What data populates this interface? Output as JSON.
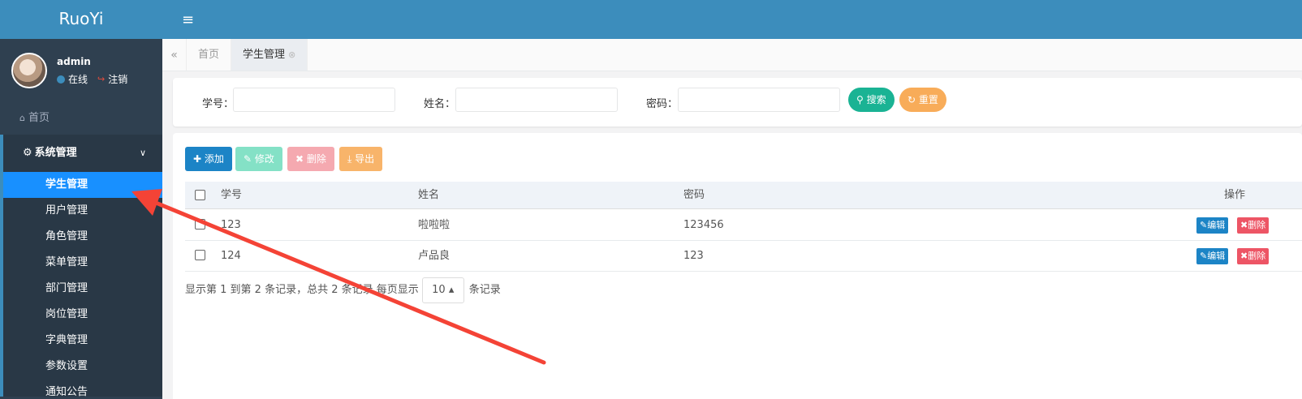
{
  "app": {
    "logo": "RuoYi"
  },
  "user": {
    "name": "admin",
    "status": "在线",
    "logout": "注销"
  },
  "sidebar": {
    "home": "首页",
    "group": "系统管理",
    "items": [
      {
        "label": "学生管理",
        "active": true
      },
      {
        "label": "用户管理"
      },
      {
        "label": "角色管理"
      },
      {
        "label": "菜单管理"
      },
      {
        "label": "部门管理"
      },
      {
        "label": "岗位管理"
      },
      {
        "label": "字典管理"
      },
      {
        "label": "参数设置"
      },
      {
        "label": "通知公告"
      }
    ]
  },
  "tabs": [
    {
      "label": "首页"
    },
    {
      "label": "学生管理",
      "active": true
    }
  ],
  "search": {
    "fields": [
      {
        "label": "学号：",
        "value": ""
      },
      {
        "label": "姓名：",
        "value": ""
      },
      {
        "label": "密码：",
        "value": ""
      }
    ],
    "search_label": "搜索",
    "reset_label": "重置"
  },
  "toolbar": {
    "add_label": "添加",
    "edit_label": "修改",
    "delete_label": "删除",
    "export_label": "导出"
  },
  "table": {
    "columns": [
      "学号",
      "姓名",
      "密码",
      "操作"
    ],
    "rows": [
      {
        "id": "123",
        "name": "啦啦啦",
        "password": "123456"
      },
      {
        "id": "124",
        "name": "卢品良",
        "password": "123"
      }
    ],
    "row_edit_label": "编辑",
    "row_delete_label": "删除"
  },
  "pagination": {
    "summary": "显示第 1 到第 2 条记录，总共 2 条记录 每页显示",
    "page_size": "10",
    "suffix": "条记录"
  },
  "colors": {
    "primary": "#3c8dbc",
    "sidebar": "#2f4050",
    "active": "#1890ff",
    "annotation": "#f44336"
  }
}
